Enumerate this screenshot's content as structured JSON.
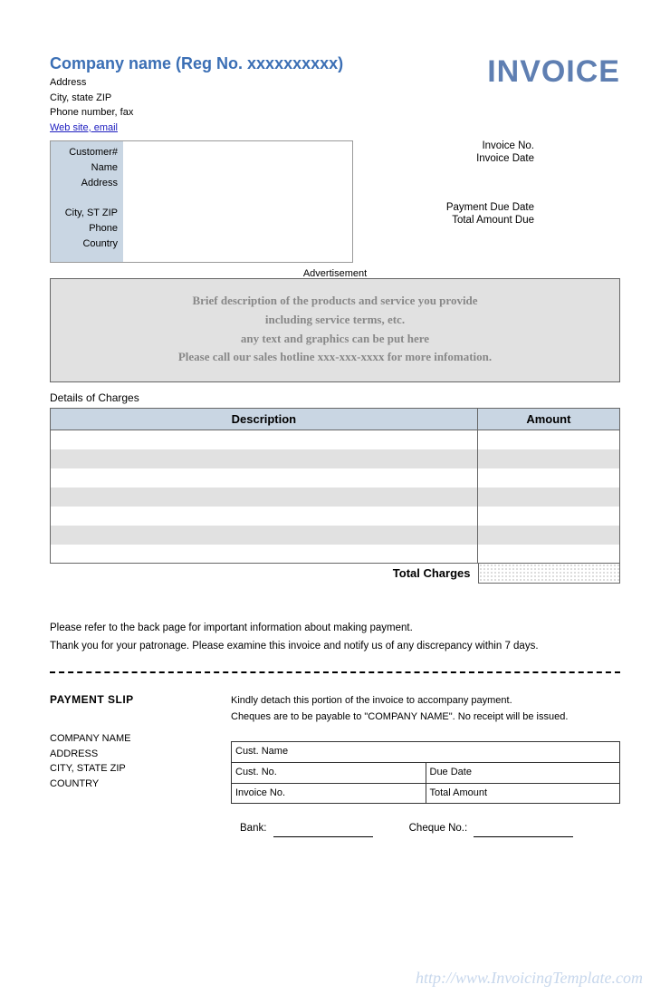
{
  "header": {
    "company_name": "Company name (Reg No. xxxxxxxxxx)",
    "address": "Address",
    "city_state_zip": "City, state ZIP",
    "phone_fax": "Phone number, fax",
    "web_email": "Web site, email",
    "invoice_label": "INVOICE"
  },
  "customer_labels": {
    "customer_no": "Customer#",
    "name": "Name",
    "address": "Address",
    "city_st_zip": "City, ST ZIP",
    "phone": "Phone",
    "country": "Country"
  },
  "invoice_meta": {
    "invoice_no_label": "Invoice No.",
    "invoice_date_label": "Invoice Date",
    "payment_due_label": "Payment Due Date",
    "total_due_label": "Total Amount Due"
  },
  "advertisement": {
    "label": "Advertisement",
    "line1": "Brief description of the products and service you provide",
    "line2": "including service terms, etc.",
    "line3": "any text and graphics can be put here",
    "line4": "Please call our sales hotline xxx-xxx-xxxx for more infomation."
  },
  "charges": {
    "section_label": "Details of Charges",
    "col_description": "Description",
    "col_amount": "Amount",
    "total_label": "Total Charges"
  },
  "notes": {
    "line1": "Please refer to the back page for important information about making payment.",
    "line2": "Thank you for your patronage. Please examine this invoice and notify us of any discrepancy within 7 days."
  },
  "payment_slip": {
    "title": "PAYMENT SLIP",
    "instruction1": "Kindly detach this portion of the invoice to accompany payment.",
    "instruction2": "Cheques are to be payable to \"COMPANY NAME\". No receipt will be issued.",
    "company_name": "COMPANY NAME",
    "address": "ADDRESS",
    "city_state_zip": "CITY, STATE ZIP",
    "country": "COUNTRY",
    "cust_name_label": "Cust. Name",
    "cust_no_label": "Cust. No.",
    "due_date_label": "Due Date",
    "invoice_no_label": "Invoice No.",
    "total_amount_label": "Total Amount",
    "bank_label": "Bank:",
    "cheque_label": "Cheque No.:"
  },
  "watermark": "http://www.InvoicingTemplate.com"
}
